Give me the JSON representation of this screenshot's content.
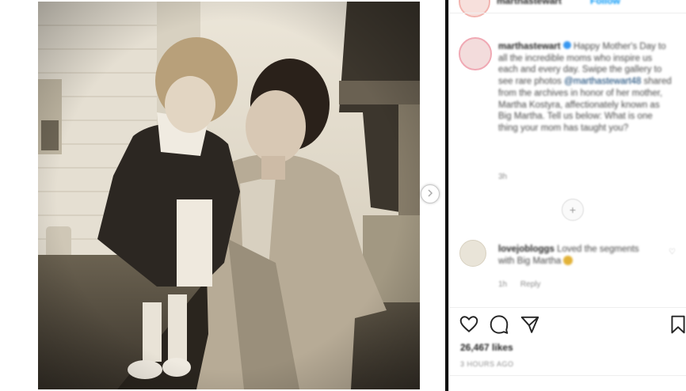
{
  "post": {
    "username": "marthastewart",
    "follow_label": "Follow",
    "caption_text": " Happy Mother's Day to all the incredible moms who inspire us each and every day. Swipe the gallery to see rare photos ",
    "caption_mention": "@marthastewart48",
    "caption_tail": " shared from the archives in honor of her mother, Martha Kostyra, affectionately known as Big Martha. Tell us below: What is one thing your mom has taught you?",
    "caption_time": "3h"
  },
  "comment": {
    "username": "lovejobloggs",
    "text": " Loved the segments with Big Martha ",
    "time": "1h",
    "reply_label": "Reply"
  },
  "engagement": {
    "likes": "26,467 likes",
    "date": "3 HOURS AGO"
  },
  "icons": {
    "next": "chevron-right-icon",
    "like": "heart-icon",
    "comment": "comment-bubble-icon",
    "share": "paper-plane-icon",
    "save": "bookmark-icon",
    "verified": "verified-badge-icon",
    "more": "plus-circle-icon"
  },
  "colors": {
    "link_blue": "#0095f6",
    "mention": "#00376b",
    "divider": "#111111"
  }
}
